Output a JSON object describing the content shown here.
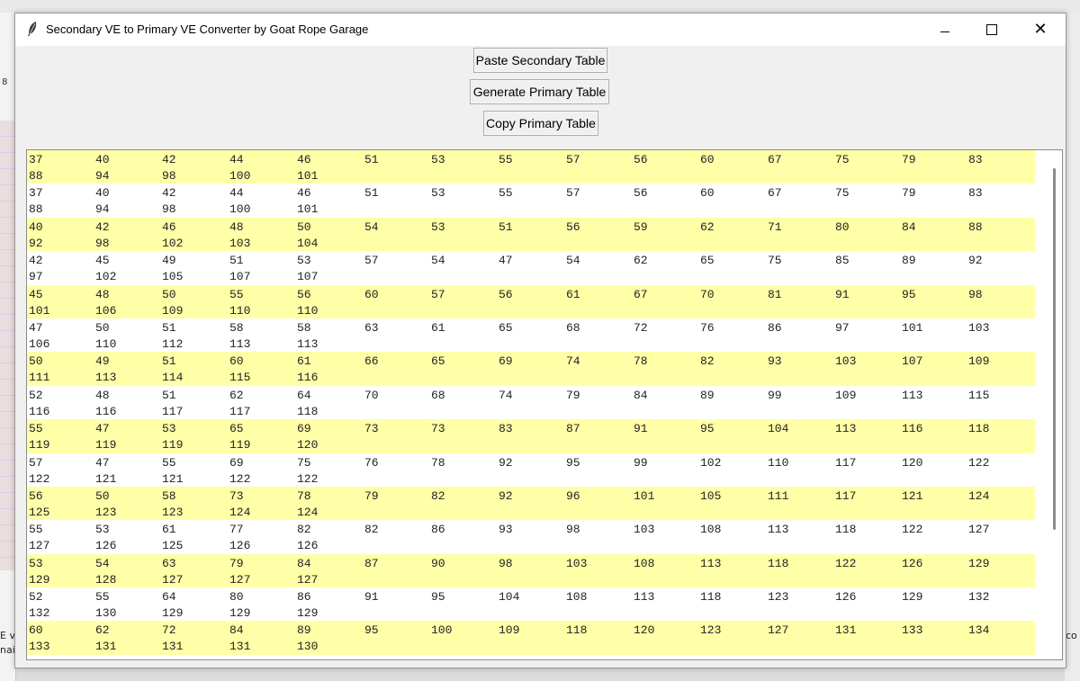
{
  "window": {
    "title": "Secondary VE to Primary VE Converter by Goat Rope Garage",
    "icons": {
      "app": "feather-icon",
      "minimize": "minimize-icon",
      "maximize": "maximize-icon",
      "close": "close-icon"
    },
    "close_glyph": "✕"
  },
  "background": {
    "left_number": "8",
    "left_text_1": "E v",
    "left_text_2": "nai",
    "right_text": "co"
  },
  "buttons": {
    "paste": "Paste Secondary Table",
    "generate": "Generate Primary Table",
    "copy": "Copy Primary Table"
  },
  "colors": {
    "row_highlight": "#ffffa8",
    "row_plain": "#ffffff"
  },
  "table": {
    "rows": [
      [
        "37",
        "40",
        "42",
        "44",
        "46",
        "51",
        "53",
        "55",
        "57",
        "56",
        "60",
        "67",
        "75",
        "79",
        "83",
        "88",
        "94",
        "98",
        "100",
        "101"
      ],
      [
        "37",
        "40",
        "42",
        "44",
        "46",
        "51",
        "53",
        "55",
        "57",
        "56",
        "60",
        "67",
        "75",
        "79",
        "83",
        "88",
        "94",
        "98",
        "100",
        "101"
      ],
      [
        "40",
        "42",
        "46",
        "48",
        "50",
        "54",
        "53",
        "51",
        "56",
        "59",
        "62",
        "71",
        "80",
        "84",
        "88",
        "92",
        "98",
        "102",
        "103",
        "104"
      ],
      [
        "42",
        "45",
        "49",
        "51",
        "53",
        "57",
        "54",
        "47",
        "54",
        "62",
        "65",
        "75",
        "85",
        "89",
        "92",
        "97",
        "102",
        "105",
        "107",
        "107"
      ],
      [
        "45",
        "48",
        "50",
        "55",
        "56",
        "60",
        "57",
        "56",
        "61",
        "67",
        "70",
        "81",
        "91",
        "95",
        "98",
        "101",
        "106",
        "109",
        "110",
        "110"
      ],
      [
        "47",
        "50",
        "51",
        "58",
        "58",
        "63",
        "61",
        "65",
        "68",
        "72",
        "76",
        "86",
        "97",
        "101",
        "103",
        "106",
        "110",
        "112",
        "113",
        "113"
      ],
      [
        "50",
        "49",
        "51",
        "60",
        "61",
        "66",
        "65",
        "69",
        "74",
        "78",
        "82",
        "93",
        "103",
        "107",
        "109",
        "111",
        "113",
        "114",
        "115",
        "116"
      ],
      [
        "52",
        "48",
        "51",
        "62",
        "64",
        "70",
        "68",
        "74",
        "79",
        "84",
        "89",
        "99",
        "109",
        "113",
        "115",
        "116",
        "116",
        "117",
        "117",
        "118"
      ],
      [
        "55",
        "47",
        "53",
        "65",
        "69",
        "73",
        "73",
        "83",
        "87",
        "91",
        "95",
        "104",
        "113",
        "116",
        "118",
        "119",
        "119",
        "119",
        "119",
        "120"
      ],
      [
        "57",
        "47",
        "55",
        "69",
        "75",
        "76",
        "78",
        "92",
        "95",
        "99",
        "102",
        "110",
        "117",
        "120",
        "122",
        "122",
        "121",
        "121",
        "122",
        "122"
      ],
      [
        "56",
        "50",
        "58",
        "73",
        "78",
        "79",
        "82",
        "92",
        "96",
        "101",
        "105",
        "111",
        "117",
        "121",
        "124",
        "125",
        "123",
        "123",
        "124",
        "124"
      ],
      [
        "55",
        "53",
        "61",
        "77",
        "82",
        "82",
        "86",
        "93",
        "98",
        "103",
        "108",
        "113",
        "118",
        "122",
        "127",
        "127",
        "126",
        "125",
        "126",
        "126"
      ],
      [
        "53",
        "54",
        "63",
        "79",
        "84",
        "87",
        "90",
        "98",
        "103",
        "108",
        "113",
        "118",
        "122",
        "126",
        "129",
        "129",
        "128",
        "127",
        "127",
        "127"
      ],
      [
        "52",
        "55",
        "64",
        "80",
        "86",
        "91",
        "95",
        "104",
        "108",
        "113",
        "118",
        "123",
        "126",
        "129",
        "132",
        "132",
        "130",
        "129",
        "129",
        "129"
      ],
      [
        "60",
        "62",
        "72",
        "84",
        "89",
        "95",
        "100",
        "109",
        "118",
        "120",
        "123",
        "127",
        "131",
        "133",
        "134",
        "133",
        "131",
        "131",
        "131",
        "130"
      ]
    ]
  }
}
